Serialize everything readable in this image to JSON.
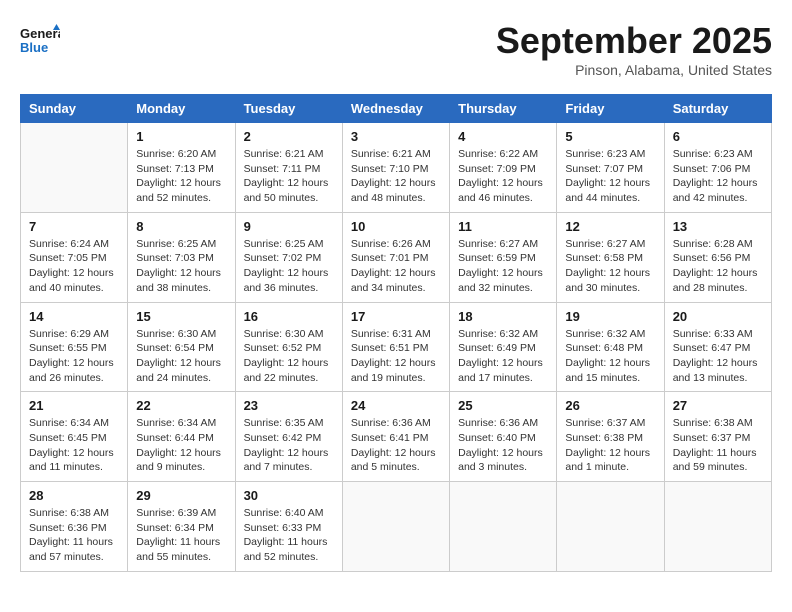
{
  "header": {
    "logo_general": "General",
    "logo_blue": "Blue",
    "month": "September 2025",
    "location": "Pinson, Alabama, United States"
  },
  "weekdays": [
    "Sunday",
    "Monday",
    "Tuesday",
    "Wednesday",
    "Thursday",
    "Friday",
    "Saturday"
  ],
  "weeks": [
    [
      {
        "day": "",
        "sunrise": "",
        "sunset": "",
        "daylight": ""
      },
      {
        "day": "1",
        "sunrise": "Sunrise: 6:20 AM",
        "sunset": "Sunset: 7:13 PM",
        "daylight": "Daylight: 12 hours and 52 minutes."
      },
      {
        "day": "2",
        "sunrise": "Sunrise: 6:21 AM",
        "sunset": "Sunset: 7:11 PM",
        "daylight": "Daylight: 12 hours and 50 minutes."
      },
      {
        "day": "3",
        "sunrise": "Sunrise: 6:21 AM",
        "sunset": "Sunset: 7:10 PM",
        "daylight": "Daylight: 12 hours and 48 minutes."
      },
      {
        "day": "4",
        "sunrise": "Sunrise: 6:22 AM",
        "sunset": "Sunset: 7:09 PM",
        "daylight": "Daylight: 12 hours and 46 minutes."
      },
      {
        "day": "5",
        "sunrise": "Sunrise: 6:23 AM",
        "sunset": "Sunset: 7:07 PM",
        "daylight": "Daylight: 12 hours and 44 minutes."
      },
      {
        "day": "6",
        "sunrise": "Sunrise: 6:23 AM",
        "sunset": "Sunset: 7:06 PM",
        "daylight": "Daylight: 12 hours and 42 minutes."
      }
    ],
    [
      {
        "day": "7",
        "sunrise": "Sunrise: 6:24 AM",
        "sunset": "Sunset: 7:05 PM",
        "daylight": "Daylight: 12 hours and 40 minutes."
      },
      {
        "day": "8",
        "sunrise": "Sunrise: 6:25 AM",
        "sunset": "Sunset: 7:03 PM",
        "daylight": "Daylight: 12 hours and 38 minutes."
      },
      {
        "day": "9",
        "sunrise": "Sunrise: 6:25 AM",
        "sunset": "Sunset: 7:02 PM",
        "daylight": "Daylight: 12 hours and 36 minutes."
      },
      {
        "day": "10",
        "sunrise": "Sunrise: 6:26 AM",
        "sunset": "Sunset: 7:01 PM",
        "daylight": "Daylight: 12 hours and 34 minutes."
      },
      {
        "day": "11",
        "sunrise": "Sunrise: 6:27 AM",
        "sunset": "Sunset: 6:59 PM",
        "daylight": "Daylight: 12 hours and 32 minutes."
      },
      {
        "day": "12",
        "sunrise": "Sunrise: 6:27 AM",
        "sunset": "Sunset: 6:58 PM",
        "daylight": "Daylight: 12 hours and 30 minutes."
      },
      {
        "day": "13",
        "sunrise": "Sunrise: 6:28 AM",
        "sunset": "Sunset: 6:56 PM",
        "daylight": "Daylight: 12 hours and 28 minutes."
      }
    ],
    [
      {
        "day": "14",
        "sunrise": "Sunrise: 6:29 AM",
        "sunset": "Sunset: 6:55 PM",
        "daylight": "Daylight: 12 hours and 26 minutes."
      },
      {
        "day": "15",
        "sunrise": "Sunrise: 6:30 AM",
        "sunset": "Sunset: 6:54 PM",
        "daylight": "Daylight: 12 hours and 24 minutes."
      },
      {
        "day": "16",
        "sunrise": "Sunrise: 6:30 AM",
        "sunset": "Sunset: 6:52 PM",
        "daylight": "Daylight: 12 hours and 22 minutes."
      },
      {
        "day": "17",
        "sunrise": "Sunrise: 6:31 AM",
        "sunset": "Sunset: 6:51 PM",
        "daylight": "Daylight: 12 hours and 19 minutes."
      },
      {
        "day": "18",
        "sunrise": "Sunrise: 6:32 AM",
        "sunset": "Sunset: 6:49 PM",
        "daylight": "Daylight: 12 hours and 17 minutes."
      },
      {
        "day": "19",
        "sunrise": "Sunrise: 6:32 AM",
        "sunset": "Sunset: 6:48 PM",
        "daylight": "Daylight: 12 hours and 15 minutes."
      },
      {
        "day": "20",
        "sunrise": "Sunrise: 6:33 AM",
        "sunset": "Sunset: 6:47 PM",
        "daylight": "Daylight: 12 hours and 13 minutes."
      }
    ],
    [
      {
        "day": "21",
        "sunrise": "Sunrise: 6:34 AM",
        "sunset": "Sunset: 6:45 PM",
        "daylight": "Daylight: 12 hours and 11 minutes."
      },
      {
        "day": "22",
        "sunrise": "Sunrise: 6:34 AM",
        "sunset": "Sunset: 6:44 PM",
        "daylight": "Daylight: 12 hours and 9 minutes."
      },
      {
        "day": "23",
        "sunrise": "Sunrise: 6:35 AM",
        "sunset": "Sunset: 6:42 PM",
        "daylight": "Daylight: 12 hours and 7 minutes."
      },
      {
        "day": "24",
        "sunrise": "Sunrise: 6:36 AM",
        "sunset": "Sunset: 6:41 PM",
        "daylight": "Daylight: 12 hours and 5 minutes."
      },
      {
        "day": "25",
        "sunrise": "Sunrise: 6:36 AM",
        "sunset": "Sunset: 6:40 PM",
        "daylight": "Daylight: 12 hours and 3 minutes."
      },
      {
        "day": "26",
        "sunrise": "Sunrise: 6:37 AM",
        "sunset": "Sunset: 6:38 PM",
        "daylight": "Daylight: 12 hours and 1 minute."
      },
      {
        "day": "27",
        "sunrise": "Sunrise: 6:38 AM",
        "sunset": "Sunset: 6:37 PM",
        "daylight": "Daylight: 11 hours and 59 minutes."
      }
    ],
    [
      {
        "day": "28",
        "sunrise": "Sunrise: 6:38 AM",
        "sunset": "Sunset: 6:36 PM",
        "daylight": "Daylight: 11 hours and 57 minutes."
      },
      {
        "day": "29",
        "sunrise": "Sunrise: 6:39 AM",
        "sunset": "Sunset: 6:34 PM",
        "daylight": "Daylight: 11 hours and 55 minutes."
      },
      {
        "day": "30",
        "sunrise": "Sunrise: 6:40 AM",
        "sunset": "Sunset: 6:33 PM",
        "daylight": "Daylight: 11 hours and 52 minutes."
      },
      {
        "day": "",
        "sunrise": "",
        "sunset": "",
        "daylight": ""
      },
      {
        "day": "",
        "sunrise": "",
        "sunset": "",
        "daylight": ""
      },
      {
        "day": "",
        "sunrise": "",
        "sunset": "",
        "daylight": ""
      },
      {
        "day": "",
        "sunrise": "",
        "sunset": "",
        "daylight": ""
      }
    ]
  ]
}
